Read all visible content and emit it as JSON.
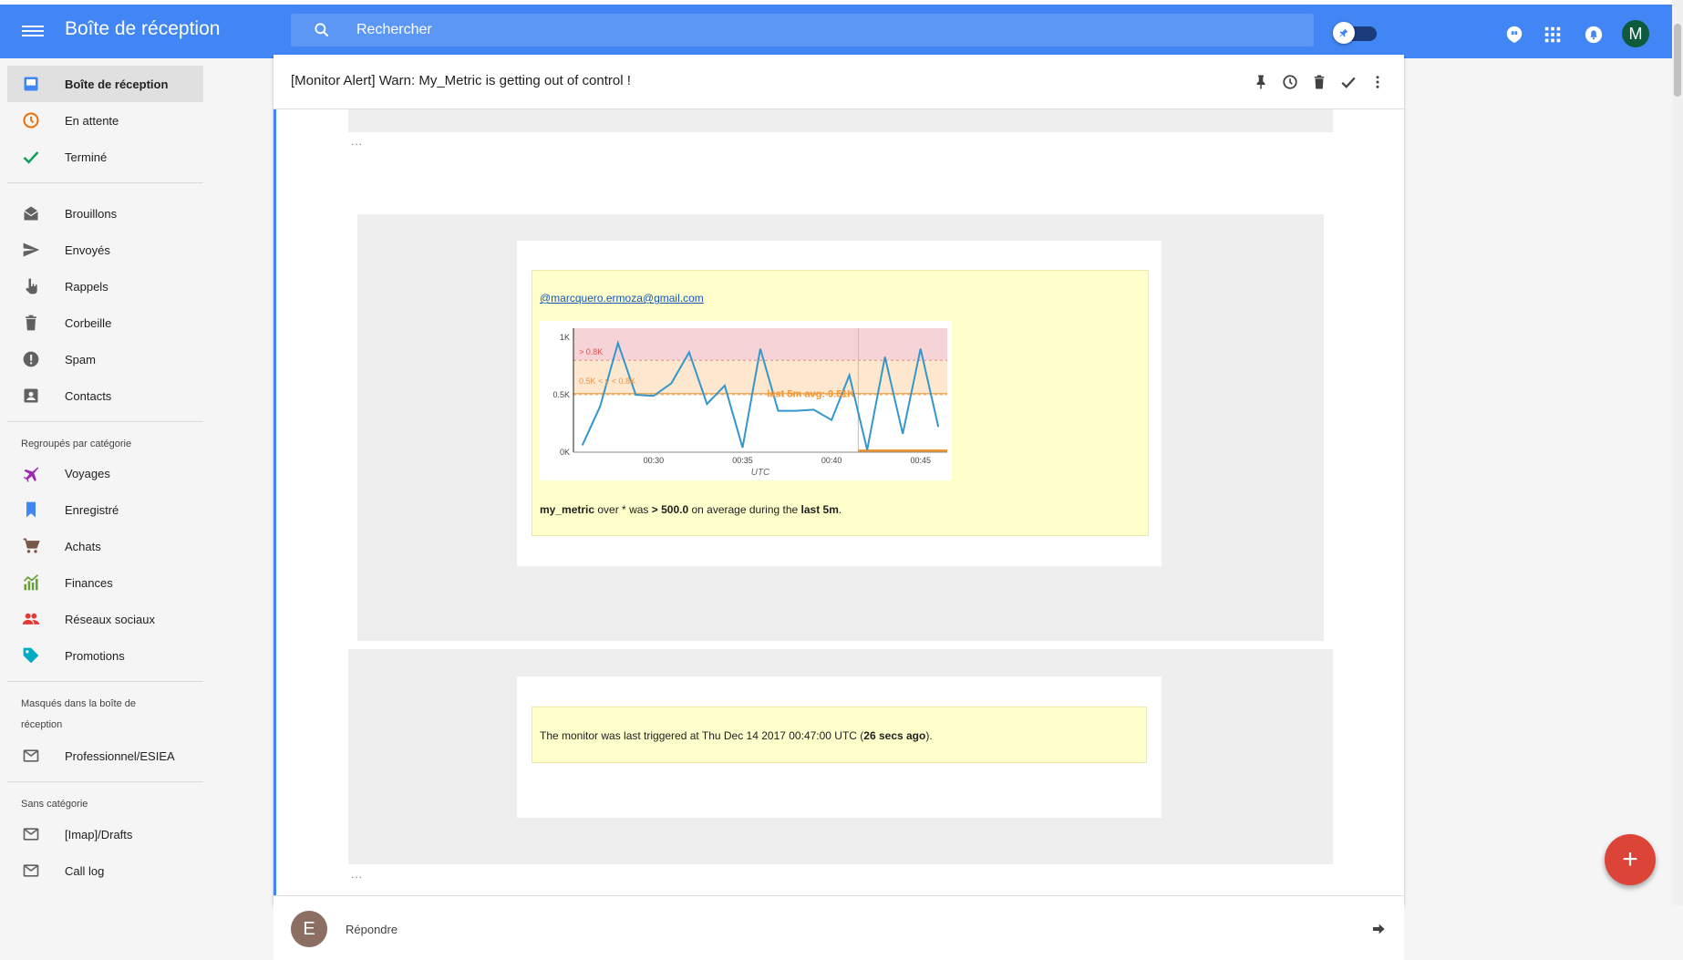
{
  "header": {
    "app_title": "Boîte de réception",
    "search_placeholder": "Rechercher",
    "avatar_letter": "M",
    "colors": {
      "brand": "#4285f4",
      "avatar": "#0e5a3c"
    }
  },
  "sidebar": {
    "main_items": [
      {
        "label": "Boîte de réception",
        "icon": "inbox-icon",
        "active": true
      },
      {
        "label": "En attente",
        "icon": "clock-icon"
      },
      {
        "label": "Terminé",
        "icon": "check-icon"
      }
    ],
    "folder_items": [
      {
        "label": "Brouillons",
        "icon": "drafts-icon"
      },
      {
        "label": "Envoyés",
        "icon": "send-icon"
      },
      {
        "label": "Rappels",
        "icon": "reminder-icon"
      },
      {
        "label": "Corbeille",
        "icon": "trash-icon"
      },
      {
        "label": "Spam",
        "icon": "spam-icon"
      },
      {
        "label": "Contacts",
        "icon": "contacts-icon"
      }
    ],
    "bundles_title": "Regroupés par catégorie",
    "bundles": [
      {
        "label": "Voyages",
        "icon": "plane-icon"
      },
      {
        "label": "Enregistré",
        "icon": "bookmark-icon"
      },
      {
        "label": "Achats",
        "icon": "cart-icon"
      },
      {
        "label": "Finances",
        "icon": "finance-icon"
      },
      {
        "label": "Réseaux sociaux",
        "icon": "people-icon"
      },
      {
        "label": "Promotions",
        "icon": "tag-icon"
      }
    ],
    "hidden_title": "Masqués dans la boîte de réception",
    "hidden_items": [
      {
        "label": "Professionnel/ESIEA",
        "icon": "mail-icon"
      }
    ],
    "uncategorized_title": "Sans catégorie",
    "uncategorized_items": [
      {
        "label": "[Imap]/Drafts",
        "icon": "mail-icon"
      },
      {
        "label": "Call log",
        "icon": "mail-icon"
      }
    ]
  },
  "message": {
    "subject": "[Monitor Alert] Warn: My_Metric is getting out of control !",
    "ellipsis": "...",
    "mention": "@marcquero.ermoza@gmail.com",
    "alert_text": {
      "metric": "my_metric",
      "part1": " over * was ",
      "threshold": "> 500.0",
      "part2": " on average during the ",
      "window": "last 5m",
      "end": "."
    },
    "trigger_text": {
      "prefix": "The monitor was last triggered at Thu Dec 14 2017 00:47:00 UTC (",
      "ago": "26 secs ago",
      "suffix": ")."
    },
    "reply_label": "Répondre",
    "reply_avatar": "E"
  },
  "chart_data": {
    "type": "line",
    "xlabel": "UTC",
    "x_ticks": [
      "00:30",
      "00:35",
      "00:40",
      "00:45"
    ],
    "y_ticks": [
      "0K",
      "0.5K",
      "1K"
    ],
    "ylim": [
      0,
      1
    ],
    "annotations": {
      "critical_band": "> 0.8K",
      "warning_band": "0.5K < y < 0.8K",
      "avg_label": "last 5m avg: 0.51K"
    },
    "critical_threshold": 0.8,
    "warning_threshold": 0.5,
    "avg_value": 0.51,
    "series": [
      {
        "x_minutes": [
          26,
          27,
          28,
          29,
          30,
          31,
          32,
          33,
          34,
          35,
          36,
          37,
          38,
          39,
          40,
          41,
          42,
          43,
          44,
          45,
          46
        ],
        "values": [
          0.06,
          0.4,
          0.95,
          0.5,
          0.49,
          0.6,
          0.87,
          0.42,
          0.58,
          0.04,
          0.9,
          0.36,
          0.36,
          0.37,
          0.28,
          0.67,
          0.02,
          0.83,
          0.16,
          0.9,
          0.22
        ]
      }
    ],
    "colors": {
      "line": "#3397cc",
      "critical": "#f5d3d6",
      "warning": "#fde7cf",
      "avg": "#f0952f"
    }
  }
}
